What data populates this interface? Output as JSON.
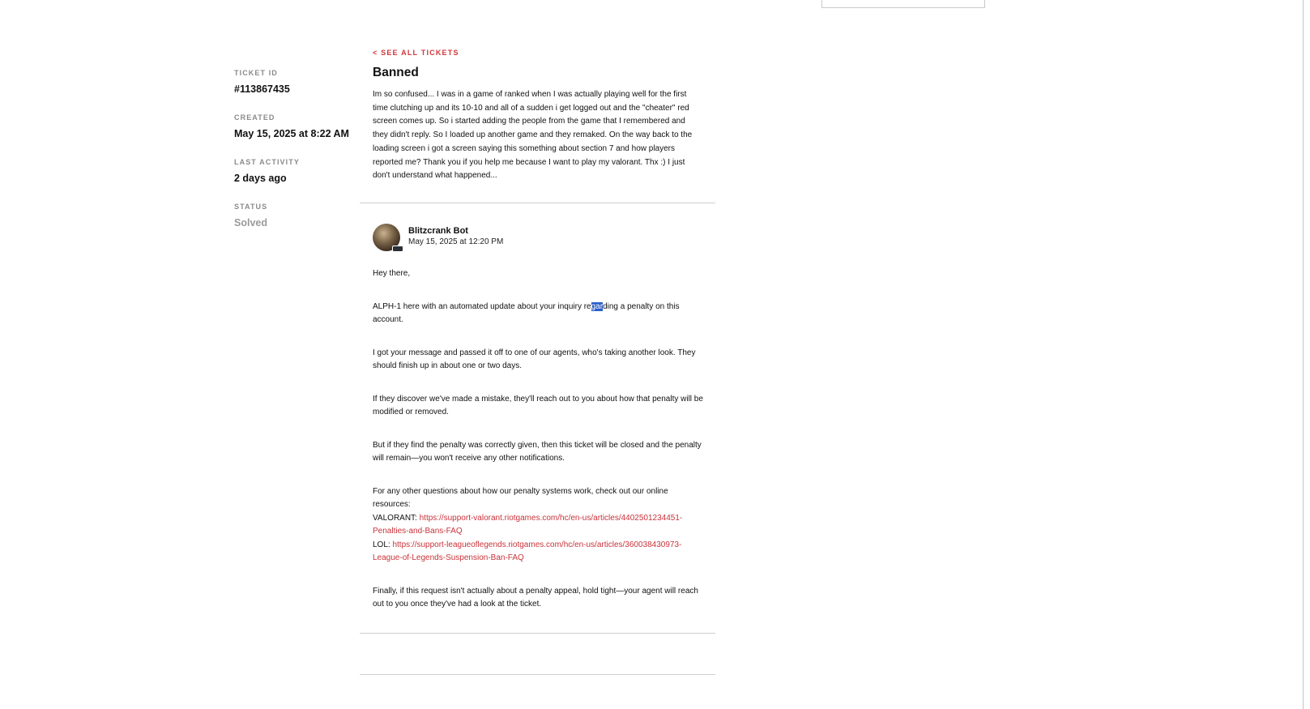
{
  "sidebar": {
    "ticket_id_label": "TICKET ID",
    "ticket_id": "#113867435",
    "created_label": "CREATED",
    "created": "May 15, 2025 at 8:22 AM",
    "last_activity_label": "LAST ACTIVITY",
    "last_activity": "2 days ago",
    "status_label": "STATUS",
    "status": "Solved"
  },
  "ticket": {
    "back_link": "< SEE ALL TICKETS",
    "title": "Banned",
    "description": "Im so confused... I was in a game of ranked when I was actually playing well for the first time clutching up and its 10-10 and all of a sudden i get logged out and the \"cheater\" red screen comes up. So i started adding the people from the game that I remembered and they didn't reply. So I loaded up another game and they remaked. On the way back to the loading screen i got a screen saying this something about section 7 and how players reported me? Thank you if you help me because I want to play my valorant. Thx :) I just don't understand what happened..."
  },
  "comment": {
    "author": "Blitzcrank Bot",
    "date": "May 15, 2025 at 12:20 PM",
    "greeting": "Hey there,",
    "p1_before": "ALPH-1 here with an automated update about your inquiry re",
    "p1_selected": "gar",
    "p1_after": "ding a penalty on this account.",
    "p2": "I got your message and passed it off to one of our agents, who's taking another look. They should finish up in about one or two days.",
    "p3": "If they discover we've made a mistake, they'll reach out to you about how that penalty will be modified or removed.",
    "p4": "But if they find the penalty was correctly given, then this ticket will be closed and the penalty will remain—you won't receive any other notifications.",
    "p5_intro": "For any other questions about how our penalty systems work, check out our online resources:",
    "valorant_label": "VALORANT: ",
    "valorant_url": "https://support-valorant.riotgames.com/hc/en-us/articles/4402501234451-Penalties-and-Bans-FAQ",
    "lol_label": "LOL: ",
    "lol_url": "https://support-leagueoflegends.riotgames.com/hc/en-us/articles/360038430973-League-of-Legends-Suspension-Ban-FAQ",
    "p6": "Finally, if this request isn't actually about a penalty appeal, hold tight—your agent will reach out to you once they've had a look at the ticket."
  },
  "colors": {
    "accent_red": "#d13639",
    "link_red": "#c8333a",
    "selection_blue": "#2a5fc9",
    "muted_gray": "#8a8a8a"
  }
}
